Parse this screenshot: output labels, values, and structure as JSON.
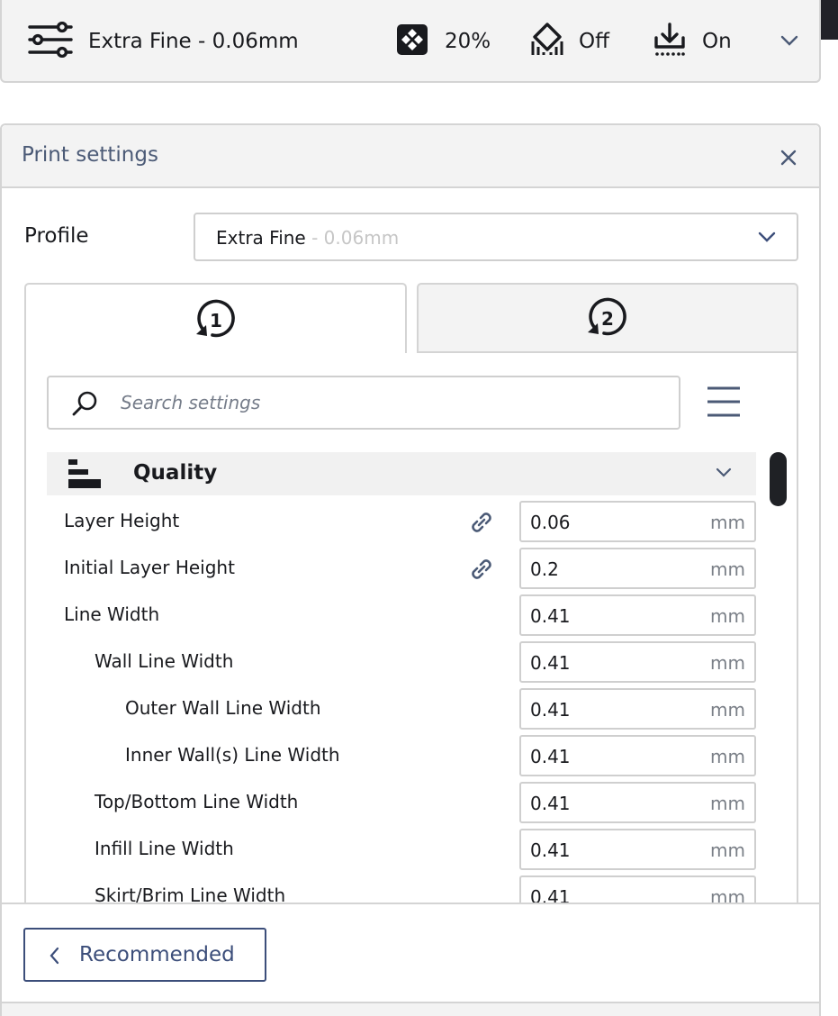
{
  "topbar": {
    "profile_label": "Extra Fine - 0.06mm",
    "infill_value": "20%",
    "support_value": "Off",
    "adhesion_value": "On",
    "icons": [
      "settings-sliders-icon",
      "infill-icon",
      "support-icon",
      "adhesion-icon",
      "chevron-down-icon"
    ]
  },
  "panel": {
    "title": "Print settings",
    "profile_label": "Profile",
    "profile_name": "Extra Fine",
    "profile_sub": " - 0.06mm",
    "tabs": [
      {
        "label": "1",
        "active": true
      },
      {
        "label": "2",
        "active": false
      }
    ],
    "search_placeholder": "Search settings",
    "category": "Quality",
    "settings": [
      {
        "name": "Layer Height",
        "value": "0.06",
        "unit": "mm",
        "indent": 0,
        "linked": true
      },
      {
        "name": "Initial Layer Height",
        "value": "0.2",
        "unit": "mm",
        "indent": 0,
        "linked": true
      },
      {
        "name": "Line Width",
        "value": "0.41",
        "unit": "mm",
        "indent": 0,
        "linked": false
      },
      {
        "name": "Wall Line Width",
        "value": "0.41",
        "unit": "mm",
        "indent": 1,
        "linked": false
      },
      {
        "name": "Outer Wall Line Width",
        "value": "0.41",
        "unit": "mm",
        "indent": 2,
        "linked": false
      },
      {
        "name": "Inner Wall(s) Line Width",
        "value": "0.41",
        "unit": "mm",
        "indent": 2,
        "linked": false
      },
      {
        "name": "Top/Bottom Line Width",
        "value": "0.41",
        "unit": "mm",
        "indent": 1,
        "linked": false
      },
      {
        "name": "Infill Line Width",
        "value": "0.41",
        "unit": "mm",
        "indent": 1,
        "linked": false
      },
      {
        "name": "Skirt/Brim Line Width",
        "value": "0.41",
        "unit": "mm",
        "indent": 1,
        "linked": false
      }
    ],
    "recommended_label": "Recommended"
  },
  "colors": {
    "accent": "#3c4e7a",
    "header_bg": "#f3f3f3",
    "border": "#d4d4d4",
    "text": "#191a1e"
  }
}
